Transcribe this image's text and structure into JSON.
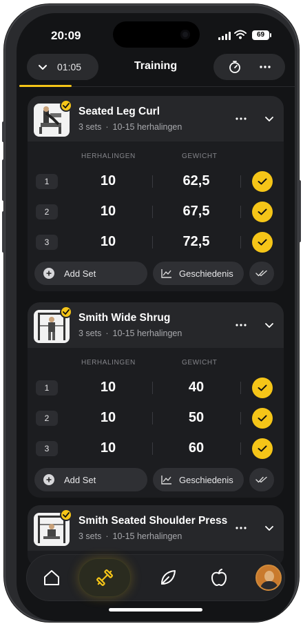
{
  "status": {
    "time": "20:09",
    "battery": "69"
  },
  "header": {
    "timer": "01:05",
    "title": "Training"
  },
  "columns": {
    "reps": "HERHALINGEN",
    "weight": "GEWICHT"
  },
  "actions": {
    "add_set": "Add Set",
    "history": "Geschiedenis"
  },
  "exercises": [
    {
      "name": "Seated Leg Curl",
      "sets": "3 sets",
      "reps_range": "10-15 herhalingen",
      "rows": [
        {
          "set": "1",
          "reps": "10",
          "weight": "62,5"
        },
        {
          "set": "2",
          "reps": "10",
          "weight": "67,5"
        },
        {
          "set": "3",
          "reps": "10",
          "weight": "72,5"
        }
      ]
    },
    {
      "name": "Smith Wide Shrug",
      "sets": "3 sets",
      "reps_range": "10-15 herhalingen",
      "rows": [
        {
          "set": "1",
          "reps": "10",
          "weight": "40"
        },
        {
          "set": "2",
          "reps": "10",
          "weight": "50"
        },
        {
          "set": "3",
          "reps": "10",
          "weight": "60"
        }
      ]
    },
    {
      "name": "Smith Seated Shoulder Press",
      "sets": "3 sets",
      "reps_range": "10-15 herhalingen"
    }
  ],
  "nav": [
    "home-icon",
    "dumbbell-icon",
    "leaf-icon",
    "apple-icon",
    "profile-avatar"
  ],
  "colors": {
    "accent": "#f5c518",
    "background": "#131416",
    "card": "#1c1d20"
  }
}
